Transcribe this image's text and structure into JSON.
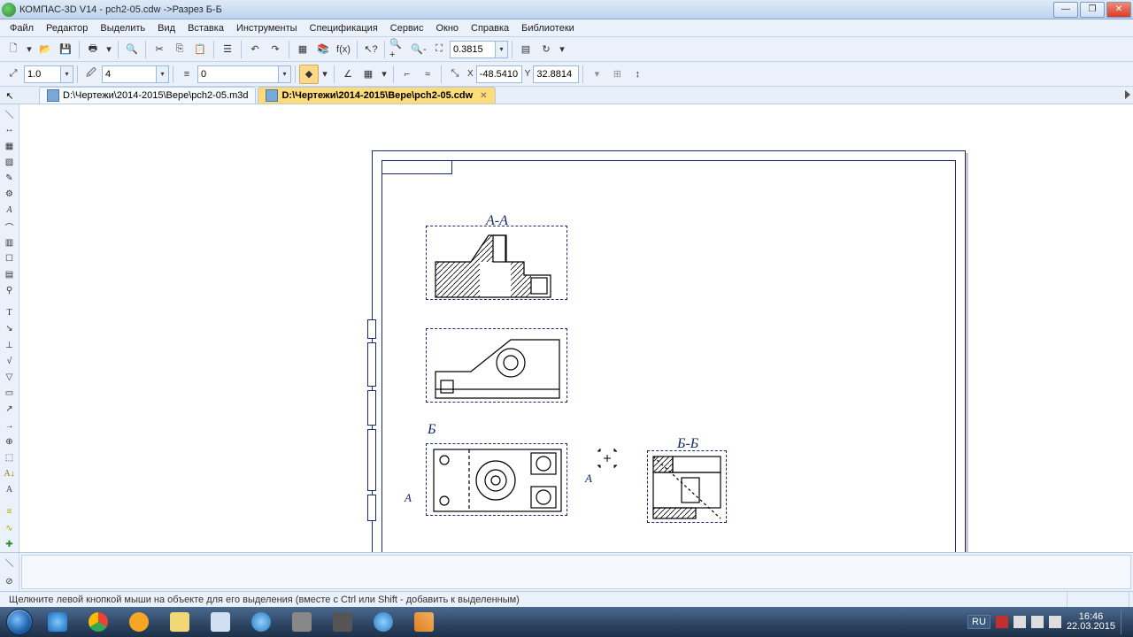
{
  "window": {
    "title": "КОМПАС-3D V14 - pch2-05.cdw ->Разрез Б-Б"
  },
  "menu": {
    "items": [
      "Файл",
      "Редактор",
      "Выделить",
      "Вид",
      "Вставка",
      "Инструменты",
      "Спецификация",
      "Сервис",
      "Окно",
      "Справка",
      "Библиотеки"
    ]
  },
  "toolbar1": {
    "zoom": "0.3815"
  },
  "toolbar2": {
    "step": "1.0",
    "styleNum": "4",
    "angle": "0",
    "x": "-48.5410",
    "y": "32.8814"
  },
  "tabs": {
    "tab1": "D:\\Чертежи\\2014-2015\\Вере\\pch2-05.m3d",
    "tab2": "D:\\Чертежи\\2014-2015\\Вере\\pch2-05.cdw"
  },
  "drawing": {
    "viewAA": "А-А",
    "viewBB": "Б-Б",
    "markA": "А",
    "markB": "Б"
  },
  "status": {
    "hint": "Щелкните левой кнопкой мыши на объекте для его выделения (вместе с Ctrl или Shift - добавить к выделенным)"
  },
  "tray": {
    "lang": "RU",
    "time": "16:46",
    "date": "22.03.2015"
  }
}
